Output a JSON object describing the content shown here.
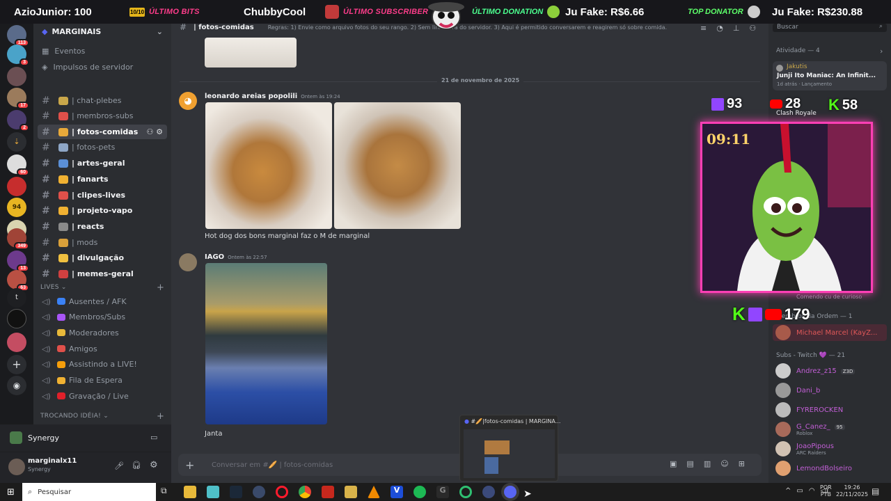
{
  "banner": {
    "left_text": "AzioJunior: 100",
    "bits_count": "10/10",
    "bits_label": "ÚLTIMO BITS",
    "bits_user": "ChubbyCool",
    "sub_label": "ÚLTIMO SUBSCRIBER",
    "donation_label": "ÚLTIMO DONATION",
    "donation_value": "Ju Fake: R$6.66",
    "top_label": "TOP DONATOR",
    "top_value": "Ju Fake: R$230.88"
  },
  "server": {
    "name": "MARGINAIS",
    "badges": [
      "113",
      "3",
      "",
      "17",
      "2",
      "",
      "60",
      "",
      "",
      "",
      "349",
      "13",
      "63"
    ]
  },
  "nav": {
    "events": "Eventos",
    "boosts": "Impulsos de servidor"
  },
  "channels": [
    {
      "label": "| chat-plebes",
      "state": "muted"
    },
    {
      "label": "| membros-subs",
      "state": "muted"
    },
    {
      "label": "| fotos-comidas",
      "state": "active"
    },
    {
      "label": "| fotos-pets",
      "state": "muted"
    },
    {
      "label": "| artes-geral",
      "state": "unread"
    },
    {
      "label": "| fanarts",
      "state": "unread"
    },
    {
      "label": "| clipes-lives",
      "state": "unread"
    },
    {
      "label": "| projeto-vapo",
      "state": "unread"
    },
    {
      "label": "| reacts",
      "state": "unread"
    },
    {
      "label": "| mods",
      "state": "muted"
    },
    {
      "label": "| divulgação",
      "state": "unread"
    },
    {
      "label": "| memes-geral",
      "state": "unread"
    }
  ],
  "categories": {
    "lives": "LIVES",
    "trocando": "TROCANDO IDÉIA!"
  },
  "voice_channels": [
    "Ausentes / AFK",
    "Membros/Subs",
    "Moderadores",
    "Amigos",
    "Assistindo a LIVE!",
    "Fila de Espera",
    "Gravação / Live"
  ],
  "voice_panel": {
    "label": "Synergy"
  },
  "user_panel": {
    "username": "marginalx11",
    "status": "Synergy"
  },
  "chat": {
    "channel_title": "| fotos-comidas",
    "topic": "Regras: 1) Envie como arquivo fotos do seu rango. 2) Sem links fora do servidor. 3) Aqui é permitido conversarem e reagirem só sobre comida.",
    "date_separator": "21 de novembro de 2025",
    "messages": [
      {
        "author": "leonardo areias popolili",
        "time": "Ontem às 19:24",
        "text": "Hot dog dos bons marginal faz o M de marginal"
      },
      {
        "author": "IAGO",
        "time": "Ontem às 22:57",
        "text": "Janta"
      }
    ],
    "composer_placeholder": "Conversar em #🥖 | fotos-comidas"
  },
  "right": {
    "search_placeholder": "Buscar",
    "activity_header": "Atividade — 4",
    "activity_user": "Jakutis",
    "activity_title": "Junji Ito Maniac: An Infinit...",
    "activity_meta": "1d atrás  · Lançamento",
    "clash_label": "Clash Royale",
    "comment_snippet": "Comendo cu de curioso",
    "member_group": "Membros da Ordem — 1",
    "member_ordem": "Michael Marcel (KayZ...",
    "subs_header": "Subs - Twitch 💜 — 21",
    "subs": [
      {
        "name": "Andrez_z15",
        "tag": "Z3D",
        "activity": ""
      },
      {
        "name": "Dani_b",
        "tag": "",
        "activity": ""
      },
      {
        "name": "FYREROCKEN",
        "tag": "",
        "activity": ""
      },
      {
        "name": "G_Canez_",
        "tag": "95",
        "activity": "Roblox"
      },
      {
        "name": "JoaoPipous",
        "tag": "",
        "activity": "ARC Raiders"
      },
      {
        "name": "LemondBolseiro",
        "tag": "",
        "activity": ""
      }
    ]
  },
  "overlay": {
    "twitch_followers": "93",
    "youtube_count": "28",
    "kick_count": "58",
    "timer": "09:11",
    "live_count": "179"
  },
  "taskbar": {
    "search": "Pesquisar",
    "lang": "POR",
    "lang2": "PTB",
    "time": "19:26",
    "date": "22/11/2025",
    "preview_title": "#🥖|fotos-comidas | MARGINA..."
  },
  "colors": {
    "accent": "#5865f2",
    "pink": "#ff3fb5",
    "green": "#53fc18",
    "twitch": "#9146ff"
  }
}
